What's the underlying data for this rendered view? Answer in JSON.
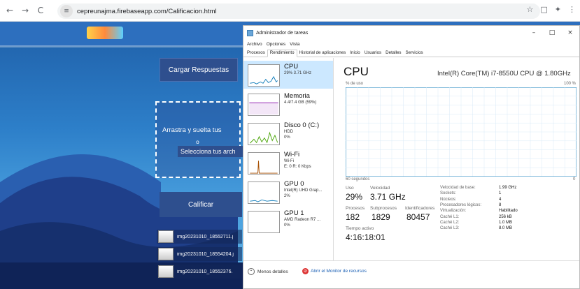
{
  "browser": {
    "url": "cepreunajma.firebaseapp.com/Calificacion.html",
    "back_icon": "←",
    "forward_icon": "→",
    "reload_icon": "C",
    "site_info_icon": "≡",
    "bookmark_icon": "☆",
    "sidepanel_icon": "□",
    "extensions_icon": "✦",
    "menu_icon": "⋮"
  },
  "page": {
    "load_button": "Cargar Respuestas",
    "drop_text": "Arrastra y suelta tus",
    "drop_or": "o",
    "select_button": "Selecciona tus arch",
    "grade_button": "Calificar",
    "files": [
      "img20231010_18552711.j",
      "img20231010_18554204.j",
      "img20231010_18552376."
    ]
  },
  "task_manager": {
    "title": "Administrador de tareas",
    "win_min": "–",
    "win_max": "□",
    "win_close": "×",
    "menu": [
      "Archivo",
      "Opciones",
      "Vista"
    ],
    "tabs": [
      "Procesos",
      "Rendimiento",
      "Historial de aplicaciones",
      "Inicio",
      "Usuarios",
      "Detalles",
      "Servicios"
    ],
    "resources": [
      {
        "name": "CPU",
        "s1": "29% 3.71 GHz",
        "s2": "",
        "color": "#117dbb"
      },
      {
        "name": "Memoria",
        "s1": "4.4/7.4 GB (59%)",
        "s2": "",
        "color": "#8b12ae"
      },
      {
        "name": "Disco 0 (C:)",
        "s1": "HDD",
        "s2": "0%",
        "color": "#4da60c"
      },
      {
        "name": "Wi-Fi",
        "s1": "Wi-Fi",
        "s2": "E: 0 R: 0 Kbps",
        "color": "#a74f01"
      },
      {
        "name": "GPU 0",
        "s1": "Intel(R) UHD Grap...",
        "s2": "2%",
        "color": "#117dbb"
      },
      {
        "name": "GPU 1",
        "s1": "AMD Radeon R7 ...",
        "s2": "0%",
        "color": "#117dbb"
      }
    ],
    "cpu": {
      "title": "CPU",
      "model": "Intel(R) Core(TM) i7-8550U CPU @ 1.80GHz",
      "usage_label": "% de uso",
      "max_label": "100 %",
      "time_label": "60 segundos",
      "min_label": "0",
      "uso_label": "Uso",
      "uso_value": "29%",
      "velocidad_label": "Velocidad",
      "velocidad_value": "3.71 GHz",
      "procesos_label": "Procesos",
      "procesos_value": "182",
      "subprocesos_label": "Subprocesos",
      "subprocesos_value": "1829",
      "identificadores_label": "Identificadores",
      "identificadores_value": "80457",
      "tiempo_label": "Tiempo activo",
      "tiempo_value": "4:16:18:01",
      "details": [
        {
          "k": "Velocidad de base:",
          "v": "1.99 GHz"
        },
        {
          "k": "Sockets:",
          "v": "1"
        },
        {
          "k": "Núcleos:",
          "v": "4"
        },
        {
          "k": "Procesadores lógicos:",
          "v": "8"
        },
        {
          "k": "Virtualización:",
          "v": "Habilitado"
        },
        {
          "k": "Caché L1:",
          "v": "256 kB"
        },
        {
          "k": "Caché L2:",
          "v": "1.0 MB"
        },
        {
          "k": "Caché L3:",
          "v": "8.0 MB"
        }
      ]
    },
    "footer": {
      "less_details": "Menos detalles",
      "open_monitor": "Abrir el Monitor de recursos",
      "less_icon": "⌃",
      "monitor_icon": "⊘"
    }
  },
  "chart_data": {
    "type": "line",
    "ylim": [
      0,
      100
    ],
    "values": [
      0,
      0,
      0,
      0,
      0,
      0,
      0,
      0,
      0,
      0,
      0,
      0,
      0,
      0,
      0,
      0,
      0,
      0,
      0,
      0,
      0,
      0,
      0,
      0,
      0,
      0,
      0,
      0,
      0,
      0,
      0,
      0,
      0,
      0,
      0,
      0,
      0,
      0,
      0,
      0,
      0,
      0,
      0,
      0,
      0,
      0,
      0,
      0,
      0,
      0,
      0,
      0,
      0,
      0,
      0,
      0,
      0,
      0,
      0,
      0
    ]
  }
}
